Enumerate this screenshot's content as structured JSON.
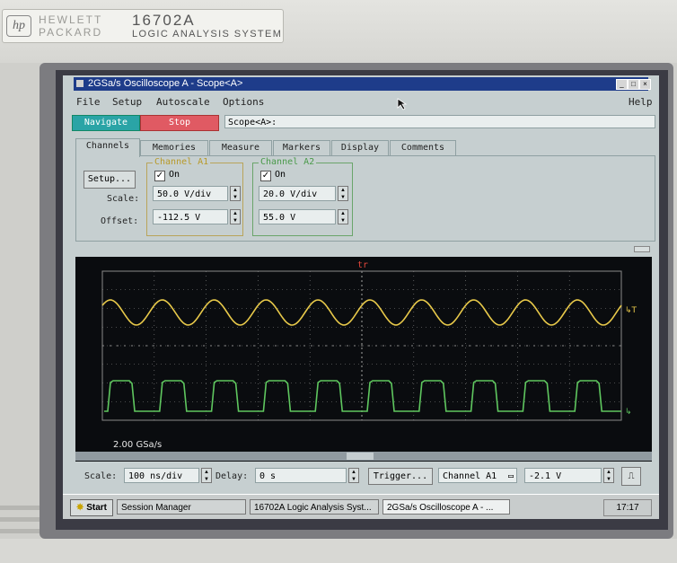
{
  "device": {
    "brand_line1": "HEWLETT",
    "brand_line2": "PACKARD",
    "model": "16702A",
    "system_name": "LOGIC ANALYSIS SYSTEM",
    "logo_icon": "hp-logo-icon"
  },
  "window": {
    "title": "2GSa/s Oscilloscope A - Scope<A>",
    "controls": [
      "minimize-button",
      "maximize-button",
      "close-button"
    ]
  },
  "menu": {
    "file": "File",
    "setup": "Setup",
    "autoscale": "Autoscale",
    "options": "Options",
    "help": "Help"
  },
  "toolbar": {
    "navigate": "Navigate",
    "stop": "Stop",
    "scope_field": "Scope<A>:"
  },
  "tabs": [
    "Channels",
    "Memories",
    "Measure",
    "Markers",
    "Display",
    "Comments"
  ],
  "channels": {
    "setup_button": "Setup...",
    "scale_label": "Scale:",
    "offset_label": "Offset:",
    "a1": {
      "title": "Channel A1",
      "on_label": "On",
      "checked": true,
      "scale": "50.0 V/div",
      "offset": "-112.5 V",
      "color": "#e8c94a"
    },
    "a2": {
      "title": "Channel A2",
      "on_label": "On",
      "checked": true,
      "scale": "20.0 V/div",
      "offset": "55.0 V",
      "color": "#5fc75f"
    }
  },
  "waveform": {
    "trigger_marker": "tr",
    "sample_rate": "2.00 GSa/s",
    "trace1_color": "#e8c94a",
    "trace2_color": "#5fc75f",
    "grid_color": "#8a8a8a"
  },
  "bottom": {
    "scale_label": "Scale:",
    "scale_value": "100 ns/div",
    "delay_label": "Delay:",
    "delay_value": "0 s",
    "trigger_button": "Trigger...",
    "trigger_source": "Channel A1",
    "trigger_level": "-2.1 V",
    "slope_icon": "rising-edge-icon"
  },
  "taskbar": {
    "start": "Start",
    "tasks": [
      "Session Manager",
      "16702A Logic Analysis Syst...",
      "2GSa/s Oscilloscope A - ..."
    ],
    "active_task": 2,
    "clock": "17:17"
  }
}
